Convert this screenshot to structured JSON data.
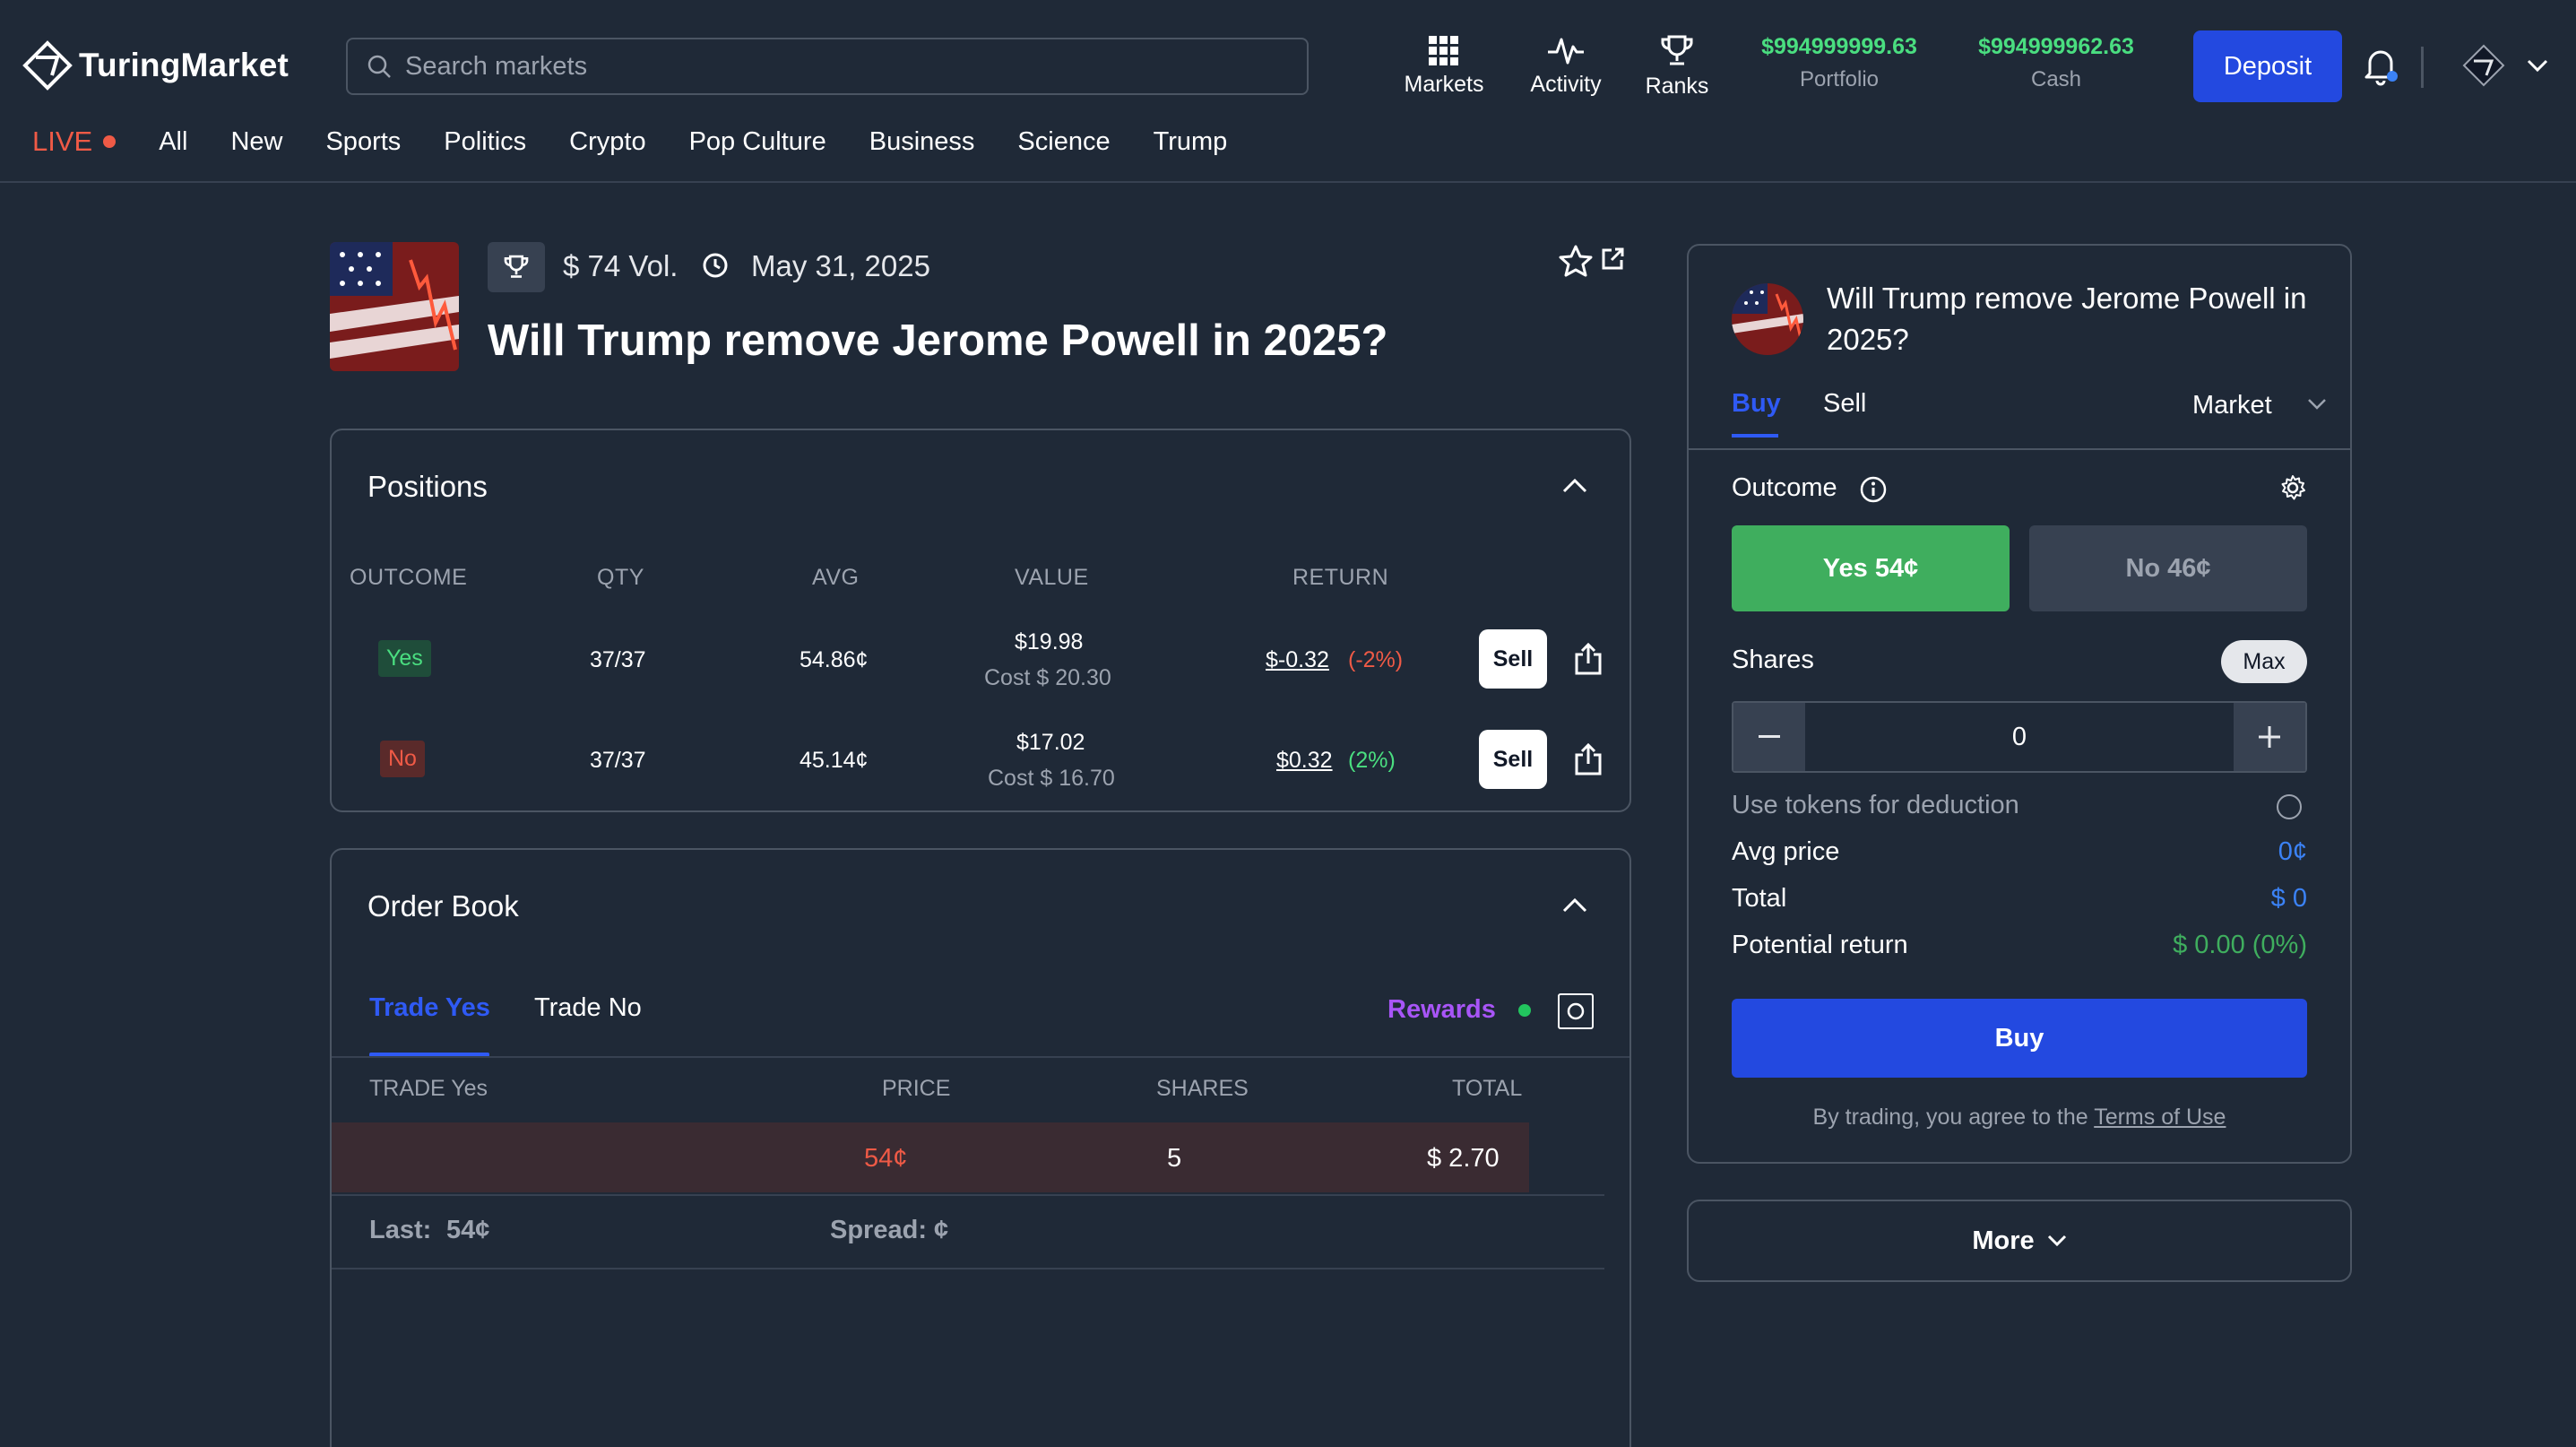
{
  "brand": {
    "name": "TuringMarket"
  },
  "search": {
    "placeholder": "Search markets"
  },
  "nav": {
    "markets": "Markets",
    "activity": "Activity",
    "ranks": "Ranks"
  },
  "account": {
    "portfolio_value": "$994999999.63",
    "portfolio_label": "Portfolio",
    "cash_value": "$994999962.63",
    "cash_label": "Cash",
    "deposit_label": "Deposit"
  },
  "categories": {
    "live": "LIVE",
    "items": [
      "All",
      "New",
      "Sports",
      "Politics",
      "Crypto",
      "Pop Culture",
      "Business",
      "Science",
      "Trump"
    ]
  },
  "market": {
    "volume": "$ 74 Vol.",
    "end_date": "May 31, 2025",
    "title": "Will Trump remove Jerome Powell in 2025?"
  },
  "positions": {
    "title": "Positions",
    "headers": [
      "OUTCOME",
      "QTY",
      "AVG",
      "VALUE",
      "RETURN"
    ],
    "rows": [
      {
        "outcome": "Yes",
        "qty": "37/37",
        "avg": "54.86¢",
        "value": "$19.98",
        "cost": "Cost $ 20.30",
        "return_value": "$-0.32",
        "return_pct": "(-2%)",
        "sell": "Sell"
      },
      {
        "outcome": "No",
        "qty": "37/37",
        "avg": "45.14¢",
        "value": "$17.02",
        "cost": "Cost $ 16.70",
        "return_value": "$0.32",
        "return_pct": "(2%)",
        "sell": "Sell"
      }
    ]
  },
  "orderbook": {
    "title": "Order Book",
    "tab_yes": "Trade Yes",
    "tab_no": "Trade No",
    "rewards": "Rewards",
    "headers": {
      "side": "TRADE Yes",
      "price": "PRICE",
      "shares": "SHARES",
      "total": "TOTAL"
    },
    "asks": [
      {
        "price": "54¢",
        "shares": "5",
        "total": "$ 2.70"
      }
    ],
    "last_label": "Last:",
    "last_value": "54¢",
    "spread_label": "Spread: ¢"
  },
  "trade": {
    "title": "Will Trump remove Jerome Powell in 2025?",
    "tab_buy": "Buy",
    "tab_sell": "Sell",
    "order_type": "Market",
    "outcome_label": "Outcome",
    "yes_label": "Yes 54¢",
    "no_label": "No 46¢",
    "shares_label": "Shares",
    "max_label": "Max",
    "shares_value": "0",
    "tokens_label": "Use tokens for deduction",
    "avg_price_label": "Avg price",
    "avg_price_value": "0¢",
    "total_label": "Total",
    "total_value": "$ 0",
    "potential_label": "Potential return",
    "potential_value": "$ 0.00 (0%)",
    "buy_label": "Buy",
    "terms_prefix": "By trading, you agree to the",
    "terms_link": "Terms of Use"
  },
  "more": {
    "label": "More"
  },
  "colors": {
    "background": "#1f2937",
    "accent_blue": "#2349e0",
    "yes_green": "#3fae5e",
    "no_red": "#ef5a46",
    "rewards_purple": "#a855f7"
  },
  "icons": [
    "logo-icon",
    "search-icon",
    "grid-icon",
    "activity-icon",
    "trophy-icon",
    "bell-icon",
    "avatar-icon",
    "chevron-down-icon",
    "clock-icon",
    "star-icon",
    "external-link-icon",
    "chevron-up-icon",
    "share-icon",
    "info-icon",
    "gear-icon",
    "minus-icon",
    "plus-icon"
  ]
}
